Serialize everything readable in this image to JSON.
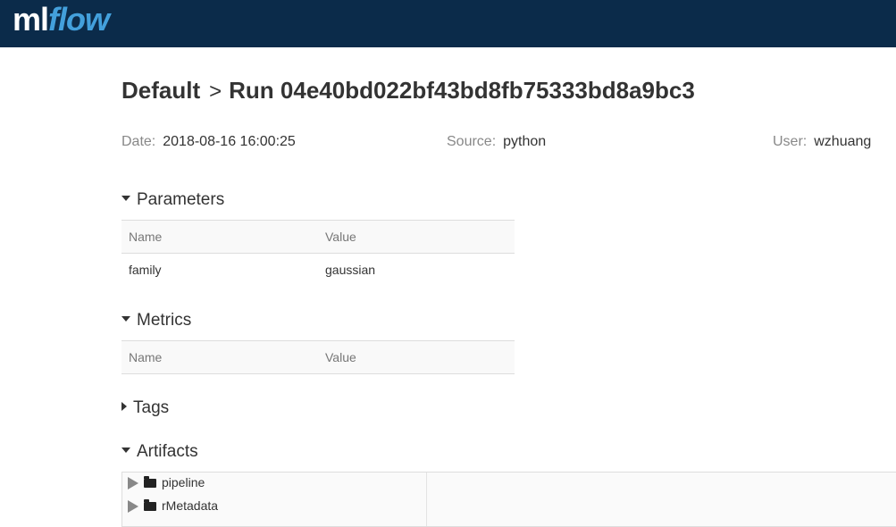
{
  "header": {
    "logo_ml": "ml",
    "logo_flow": "flow"
  },
  "breadcrumb": {
    "experiment": "Default",
    "separator": ">",
    "run": "Run 04e40bd022bf43bd8fb75333bd8a9bc3"
  },
  "meta": {
    "date_label": "Date:",
    "date_value": "2018-08-16 16:00:25",
    "source_label": "Source:",
    "source_value": "python",
    "user_label": "User:",
    "user_value": "wzhuang"
  },
  "parameters": {
    "title": "Parameters",
    "col_name": "Name",
    "col_value": "Value",
    "rows": [
      {
        "name": "family",
        "value": "gaussian"
      }
    ]
  },
  "metrics": {
    "title": "Metrics",
    "col_name": "Name",
    "col_value": "Value"
  },
  "tags": {
    "title": "Tags"
  },
  "artifacts": {
    "title": "Artifacts",
    "items": [
      {
        "label": "pipeline"
      },
      {
        "label": "rMetadata"
      }
    ]
  }
}
